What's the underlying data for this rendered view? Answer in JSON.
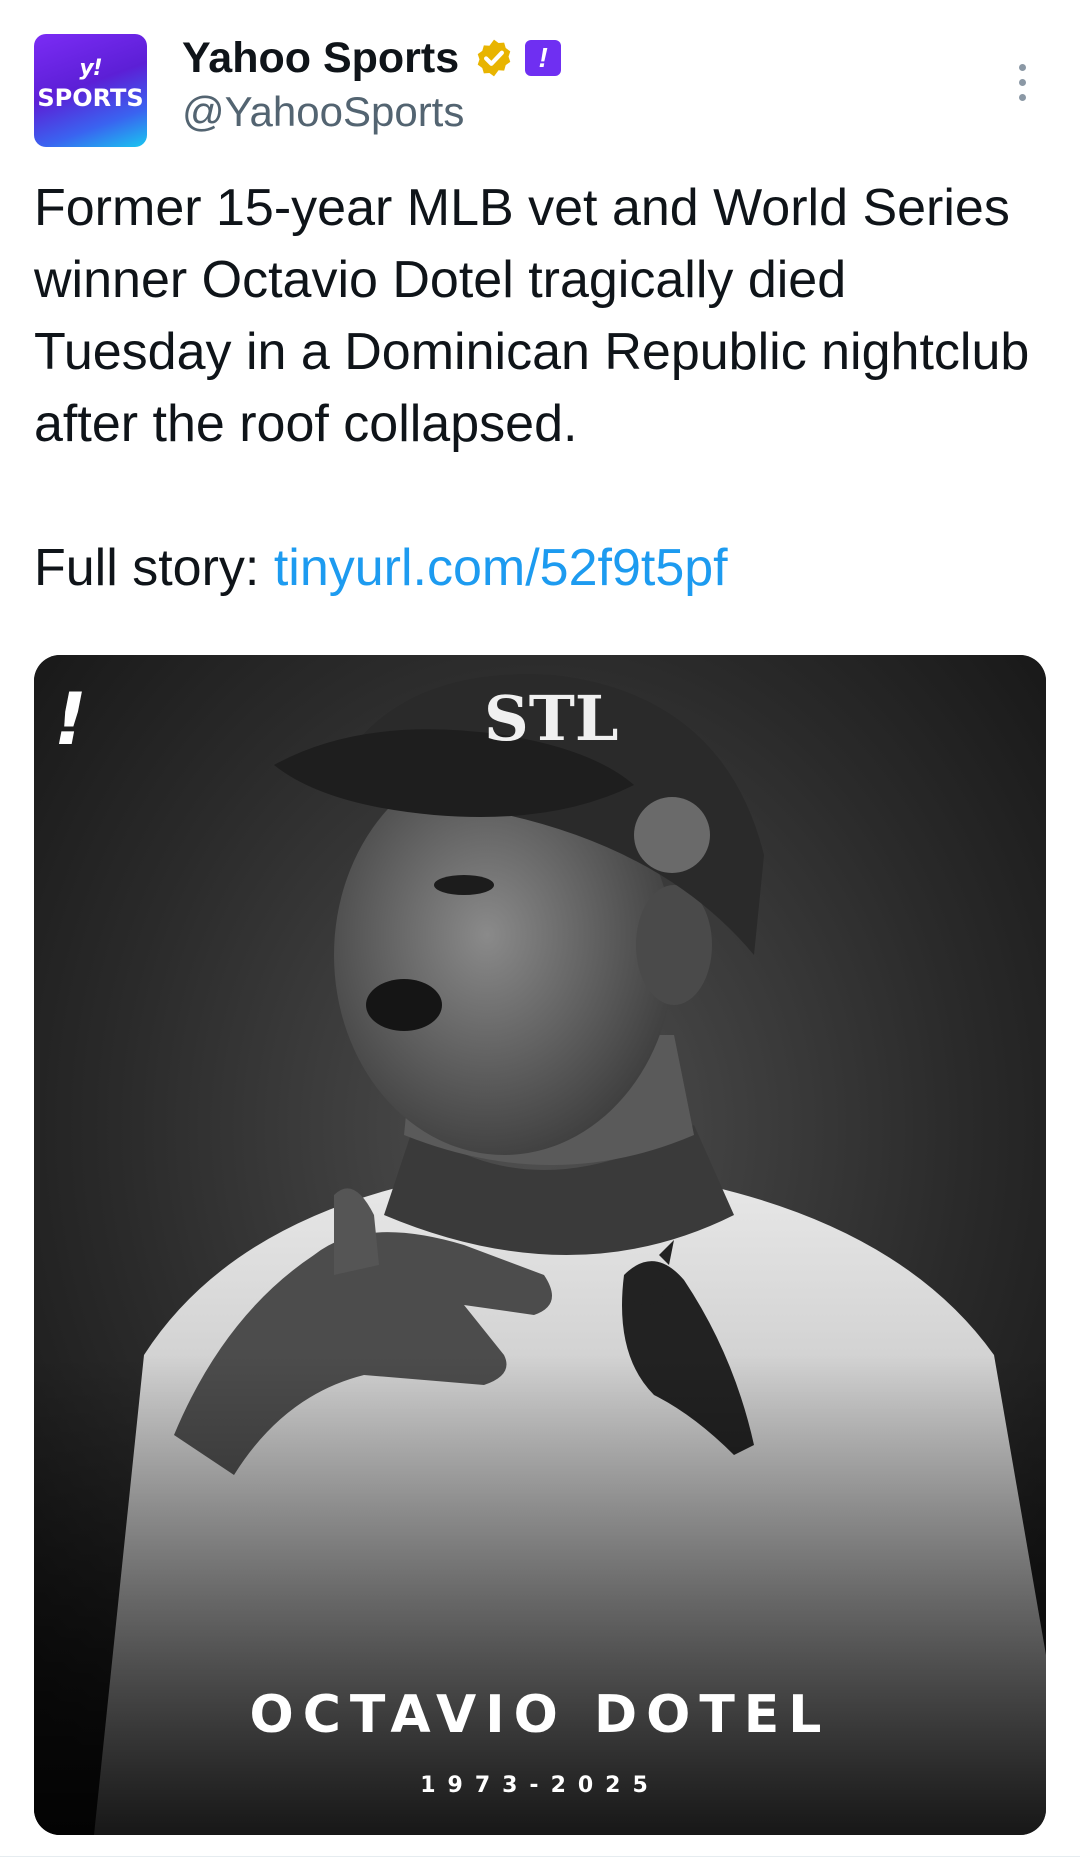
{
  "author": {
    "display_name": "Yahoo Sports",
    "handle": "@YahooSports",
    "avatar_mark": "y!",
    "avatar_text": "SPORTS",
    "affiliate_badge": "!",
    "verified_color": "#e8b400"
  },
  "tweet": {
    "text": "Former 15-year MLB vet and World Series winner Octavio Dotel tragically died Tuesday in a Dominican Republic nightclub after the roof collapsed.",
    "link_prefix": "Full story: ",
    "link_text": "tinyurl.com/52f9t5pf"
  },
  "media": {
    "brand_mark": "!",
    "player_name": "OCTAVIO DOTEL",
    "years": "1973-2025",
    "cap_logo": "STL"
  },
  "icons": {
    "more": "more-vertical-icon",
    "verified": "verified-badge-icon"
  }
}
